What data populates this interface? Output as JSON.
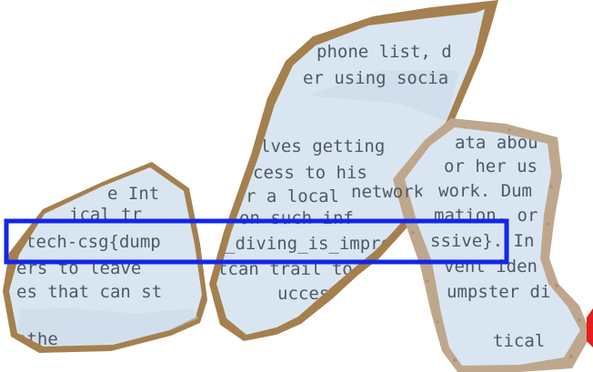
{
  "scene": {
    "description_label": "Torn paper fragments on cardboard and cork backing with one highlighted line of text",
    "fragments": [
      {
        "name": "fragment-left",
        "lines": [
          "e Int",
          "ical tr",
          "tech-csg{dump",
          "ers to leave",
          "es that can st",
          "othe"
        ]
      },
      {
        "name": "fragment-middle",
        "lines": [
          "phone list, d",
          "er using socia",
          "lves getting",
          "cess to his",
          "r a local",
          "on such inf",
          "_diving_is_impre",
          "tcan trail to prev",
          "uccessful dumpster",
          "network. Dump"
        ]
      },
      {
        "name": "fragment-right",
        "lines": [
          "ata abou",
          "or her us",
          "work. Dum",
          "mation, or",
          "ssive}. In",
          "vent iden",
          "umpster di",
          "tical"
        ]
      }
    ],
    "highlight": {
      "color": "#1226e8",
      "text": "tech-csg{dump_diving_is_impressive}. In"
    }
  }
}
